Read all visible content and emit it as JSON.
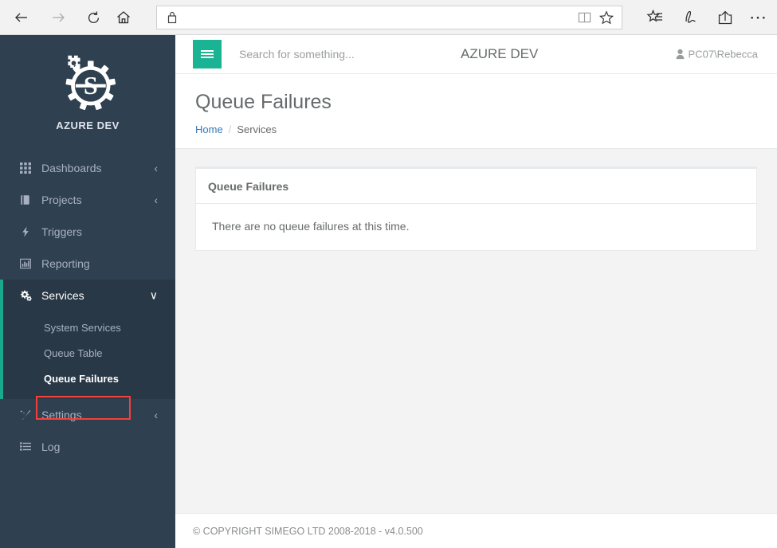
{
  "browser": {
    "back_label": "Back",
    "forward_label": "Forward",
    "refresh_label": "Refresh",
    "home_label": "Home",
    "url_value": "",
    "url_placeholder": "",
    "reading_view_label": "Reading view",
    "favorites_label": "Add to favorites",
    "hub_label": "Hub (favorites, reading list, history, downloads)",
    "web_note_label": "Make a Web Note",
    "share_label": "Share",
    "more_label": "More"
  },
  "sidebar": {
    "brand_name": "AZURE DEV",
    "logo_name": "simego-gear-logo",
    "items": [
      {
        "label": "Dashboards",
        "icon": "grid-icon",
        "caret": "‹",
        "active": false
      },
      {
        "label": "Projects",
        "icon": "book-icon",
        "caret": "‹",
        "active": false
      },
      {
        "label": "Triggers",
        "icon": "bolt-icon",
        "caret": "",
        "active": false
      },
      {
        "label": "Reporting",
        "icon": "bar-chart-icon",
        "caret": "",
        "active": false
      },
      {
        "label": "Services",
        "icon": "gears-icon",
        "caret": "∨",
        "active": true
      }
    ],
    "submenu": [
      {
        "label": "System Services",
        "current": false
      },
      {
        "label": "Queue Table",
        "current": false
      },
      {
        "label": "Queue Failures",
        "current": true
      }
    ],
    "items_after": [
      {
        "label": "Settings",
        "icon": "wand-icon",
        "caret": "‹"
      },
      {
        "label": "Log",
        "icon": "list-icon",
        "caret": ""
      }
    ],
    "accent_color": "#19aa8d",
    "background_color": "#2f4050",
    "submenu_background_color": "#293846"
  },
  "topbar": {
    "menu_toggle_label": "Toggle navigation",
    "search_placeholder": "Search for something...",
    "search_value": "",
    "title": "AZURE DEV",
    "user_name": "PC07\\Rebecca",
    "user_icon": "person-icon",
    "toggle_color": "#1ab394"
  },
  "page": {
    "title": "Queue Failures",
    "breadcrumb": {
      "home": "Home",
      "separator": "/",
      "current": "Services"
    }
  },
  "panel": {
    "heading": "Queue Failures",
    "body_text": "There are no queue failures at this time."
  },
  "footer": {
    "copyright": "© COPYRIGHT SIMEGO LTD 2008-2018 - v4.0.500"
  },
  "annotation": {
    "target": "Queue Failures",
    "color": "#f4403a"
  }
}
